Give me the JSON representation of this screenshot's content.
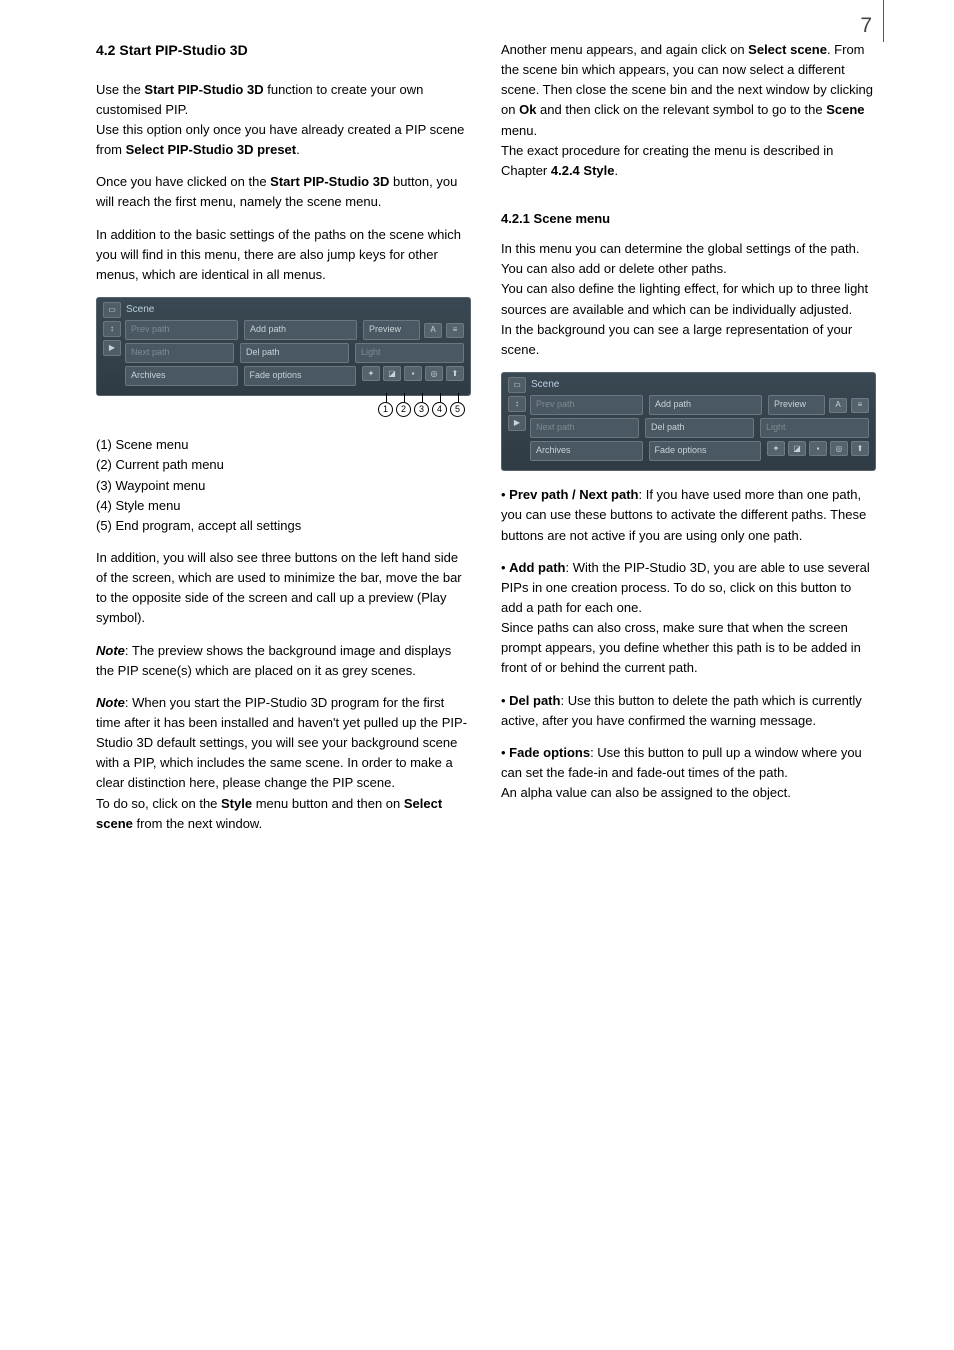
{
  "page_number": "7",
  "left": {
    "h2": "4.2 Start PIP-Studio 3D",
    "p1a": "Use the ",
    "p1b": "Start PIP-Studio 3D",
    "p1c": " function to create your own customised PIP.",
    "p2a": "Use this option only once you have already created a PIP scene from ",
    "p2b": "Select PIP-Studio 3D preset",
    "p2c": ".",
    "p3a": "Once you have clicked on the ",
    "p3b": "Start PIP-Studio 3D",
    "p3c": " button, you will reach the first menu, namely the scene menu.",
    "p4": "In addition to the basic settings of the paths on the scene which you will find in this menu, there are also jump keys for other menus, which are identical in all menus.",
    "list1": "(1) Scene menu",
    "list2": "(2) Current path menu",
    "list3": "(3) Waypoint menu",
    "list4": "(4) Style menu",
    "list5": "(5) End program, accept all settings",
    "p5": "In addition, you will also see three buttons on the left hand side of the screen, which are used to minimize the bar, move the bar to the opposite side of the screen and call up a preview (Play symbol).",
    "p6a": "Note",
    "p6b": ": The preview shows the background image and displays the PIP scene(s) which are placed on it as grey scenes.",
    "p7a": "Note",
    "p7b": ": When you start the PIP-Studio 3D program for the first time after it has been installed and haven't yet pulled up the PIP-Studio 3D default settings, you will see your background scene with a PIP, which includes the same scene. In order to make a clear distinction here, please change the PIP scene.",
    "p8a": "To do so, click on the ",
    "p8b": "Style",
    "p8c": " menu button and then on ",
    "p8d": "Select scene",
    "p8e": " from the next window."
  },
  "right": {
    "p1a": "Another menu appears, and again click on ",
    "p1b": "Select scene",
    "p1c": ". From the scene bin which appears, you can now select a different scene. Then close the scene bin and the next window by clicking on ",
    "p1d": "Ok",
    "p1e": " and then click on the relevant symbol to go to the ",
    "p1f": "Scene",
    "p1g": " menu.",
    "p2a": "The exact procedure for creating the menu is described in Chapter ",
    "p2b": "4.2.4 Style",
    "p2c": ".",
    "h3": "4.2.1 Scene menu",
    "p3": "In this menu you can determine the global settings of the path. You can also add or delete other paths.",
    "p4": "You can also define the lighting effect, for which up to three light sources are available and which can be individually adjusted.",
    "p5": "In the background you can see a large representation of your scene.",
    "b1a": "• ",
    "b1b": "Prev path / Next path",
    "b1c": ": If you have used more than one path, you can use these buttons to activate the different paths. These buttons are not active if you are using only one path.",
    "b2a": "• ",
    "b2b": "Add path",
    "b2c": ": With the PIP-Studio 3D, you are able to use several PIPs in one creation process. To do so, click on this button to add a path for each one.",
    "b2d": "Since paths can also cross, make sure that when the screen prompt appears, you define whether this path is to be added in front of or behind the current path.",
    "b3a": "• ",
    "b3b": "Del path",
    "b3c": ": Use this button to delete the path which is currently active, after you have confirmed the warning message.",
    "b4a": "• ",
    "b4b": "Fade options",
    "b4c": ": Use this button to pull up a window where you can set the fade-in and fade-out times of the path.",
    "b4d": "An alpha value can also be assigned to the object."
  },
  "panel": {
    "title": "Scene",
    "prev": "Prev path",
    "next": "Next path",
    "add": "Add path",
    "del": "Del path",
    "preview": "Preview",
    "light": "Light",
    "archives": "Archives",
    "fade": "Fade options"
  },
  "circles": {
    "c1": "1",
    "c2": "2",
    "c3": "3",
    "c4": "4",
    "c5": "5"
  }
}
